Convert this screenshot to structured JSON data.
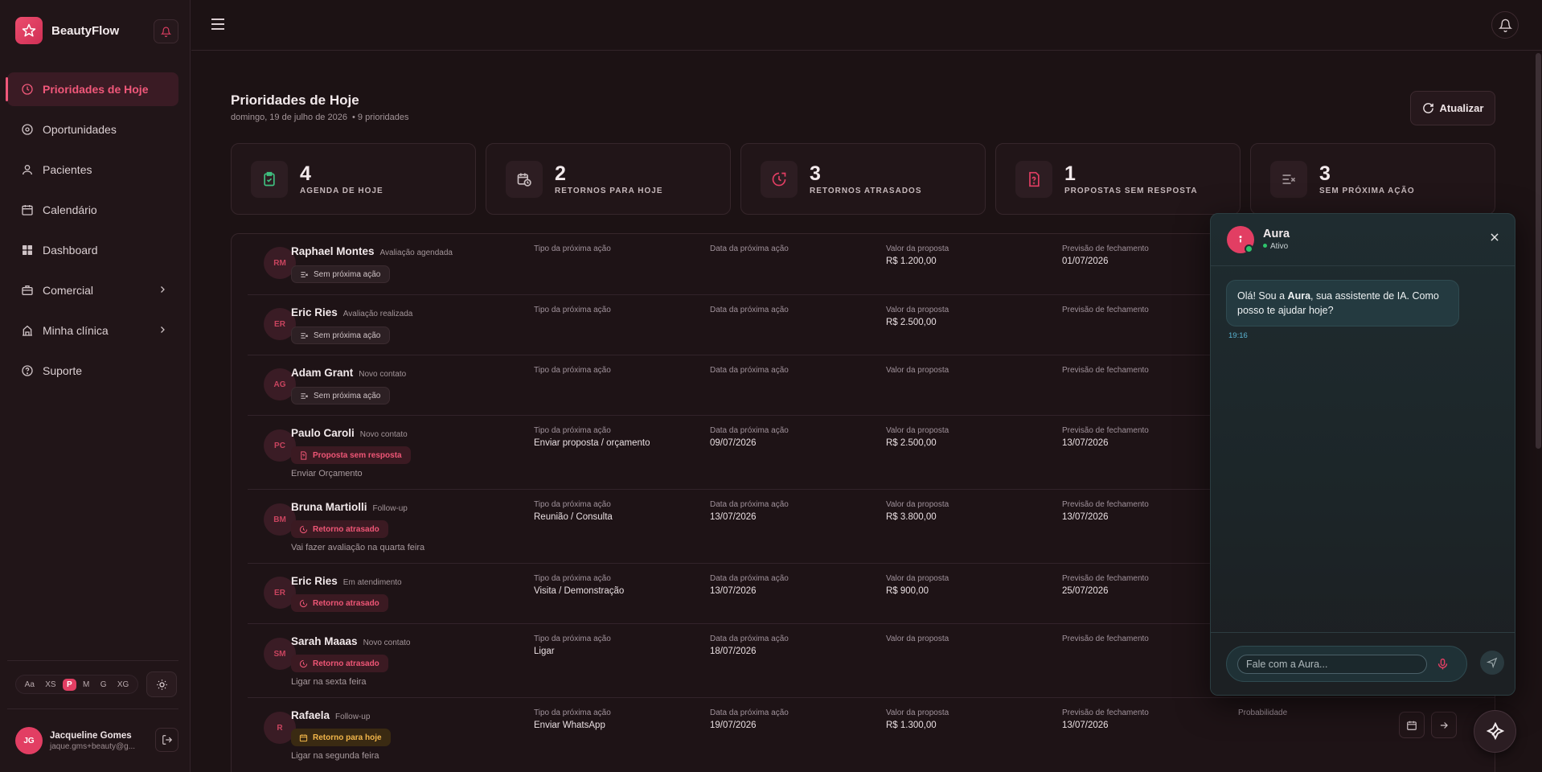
{
  "app": {
    "name": "BeautyFlow"
  },
  "sidebar": {
    "items": [
      {
        "label": "Prioridades de Hoje",
        "icon": "clock-icon",
        "active": true
      },
      {
        "label": "Oportunidades",
        "icon": "target-icon"
      },
      {
        "label": "Pacientes",
        "icon": "user-icon"
      },
      {
        "label": "Calendário",
        "icon": "calendar-icon"
      },
      {
        "label": "Dashboard",
        "icon": "grid-icon"
      },
      {
        "label": "Comercial",
        "icon": "briefcase-icon",
        "expandable": true
      },
      {
        "label": "Minha clínica",
        "icon": "building-icon",
        "expandable": true
      },
      {
        "label": "Suporte",
        "icon": "help-icon"
      }
    ],
    "font_sizes": [
      "Aa",
      "XS",
      "P",
      "M",
      "G",
      "XG"
    ],
    "font_size_selected": "P",
    "user": {
      "initials": "JG",
      "name": "Jacqueline Gomes",
      "email": "jaque.gms+beauty@g..."
    }
  },
  "page": {
    "title": "Prioridades de Hoje",
    "date": "domingo, 19 de julho de 2026",
    "count": "• 9 prioridades",
    "refresh_label": "Atualizar"
  },
  "kpis": [
    {
      "value": "4",
      "label": "AGENDA DE HOJE",
      "icon": "clipboard-check-icon",
      "color": "#3fbf7f"
    },
    {
      "value": "2",
      "label": "RETORNOS PARA HOJE",
      "icon": "calendar-clock-icon",
      "color": "#c8bcbf"
    },
    {
      "value": "3",
      "label": "RETORNOS ATRASADOS",
      "icon": "clock-alert-icon",
      "color": "#e23e63"
    },
    {
      "value": "1",
      "label": "PROPOSTAS SEM RESPOSTA",
      "icon": "file-question-icon",
      "color": "#e23e63"
    },
    {
      "value": "3",
      "label": "SEM PRÓXIMA AÇÃO",
      "icon": "list-x-icon",
      "color": "#9d9094"
    }
  ],
  "columns": {
    "next_type": "Tipo da próxima ação",
    "next_date": "Data da próxima ação",
    "proposal": "Valor da proposta",
    "closing": "Previsão de fechamento",
    "probability": "Probabilidade"
  },
  "rows": [
    {
      "initials": "RM",
      "name": "Raphael Montes",
      "stage": "Avaliação agendada",
      "badge": "Sem próxima ação",
      "note": "",
      "next_type": "",
      "next_date": "",
      "proposal": "R$ 1.200,00",
      "closing": "01/07/2026"
    },
    {
      "initials": "ER",
      "name": "Eric Ries",
      "stage": "Avaliação realizada",
      "badge": "Sem próxima ação",
      "note": "",
      "next_type": "",
      "next_date": "",
      "proposal": "R$ 2.500,00",
      "closing": ""
    },
    {
      "initials": "AG",
      "name": "Adam Grant",
      "stage": "Novo contato",
      "badge": "Sem próxima ação",
      "note": "",
      "next_type": "",
      "next_date": "",
      "proposal": "",
      "closing": ""
    },
    {
      "initials": "PC",
      "name": "Paulo Caroli",
      "stage": "Novo contato",
      "badge": "Proposta sem resposta",
      "note": "Enviar Orçamento",
      "next_type": "Enviar proposta / orçamento",
      "next_date": "09/07/2026",
      "proposal": "R$ 2.500,00",
      "closing": "13/07/2026"
    },
    {
      "initials": "BM",
      "name": "Bruna Martiolli",
      "stage": "Follow-up",
      "badge": "Retorno atrasado",
      "note": "Vai fazer avaliação na quarta feira",
      "next_type": "Reunião / Consulta",
      "next_date": "13/07/2026",
      "proposal": "R$ 3.800,00",
      "closing": "13/07/2026"
    },
    {
      "initials": "ER",
      "name": "Eric Ries",
      "stage": "Em atendimento",
      "badge": "Retorno atrasado",
      "note": "",
      "next_type": "Visita / Demonstração",
      "next_date": "13/07/2026",
      "proposal": "R$ 900,00",
      "closing": "25/07/2026"
    },
    {
      "initials": "SM",
      "name": "Sarah Maaas",
      "stage": "Novo contato",
      "badge": "Retorno atrasado",
      "note": "Ligar na sexta feira",
      "next_type": "Ligar",
      "next_date": "18/07/2026",
      "proposal": "",
      "closing": ""
    },
    {
      "initials": "R",
      "name": "Rafaela",
      "stage": "Follow-up",
      "badge": "Retorno para hoje",
      "note": "Ligar na segunda feira",
      "next_type": "Enviar WhatsApp",
      "next_date": "19/07/2026",
      "proposal": "R$ 1.300,00",
      "closing": "13/07/2026"
    }
  ],
  "chat": {
    "title": "Aura",
    "status": "Ativo",
    "message_pre": "Olá! Sou a ",
    "message_name": "Aura",
    "message_post": ", sua assistente de IA. Como posso te ajudar hoje?",
    "time": "19:16",
    "placeholder": "Fale com a Aura..."
  },
  "colors": {
    "accent": "#e23e63",
    "online": "#2ec46b",
    "warning": "#f2b64a"
  }
}
